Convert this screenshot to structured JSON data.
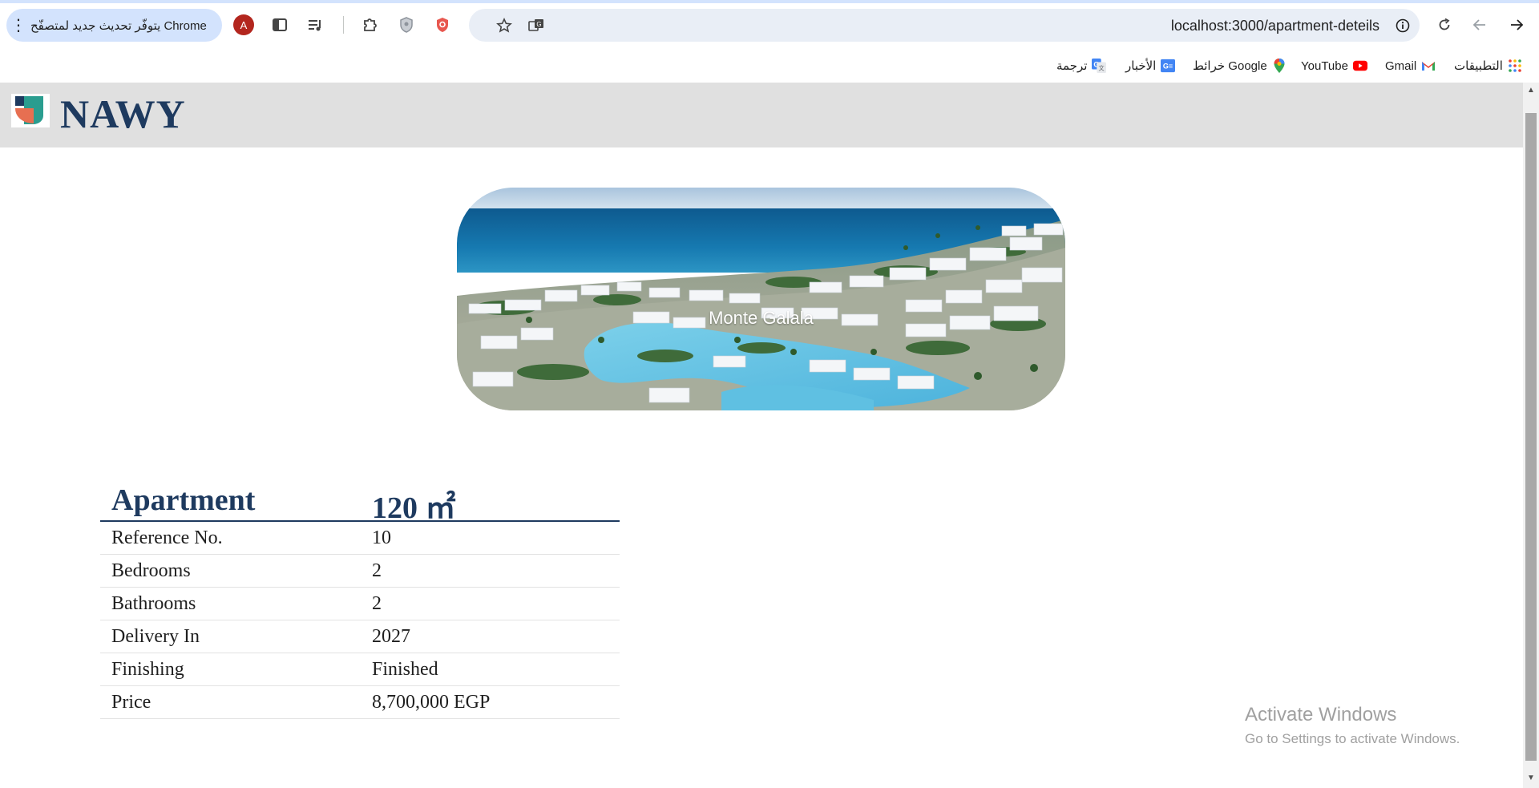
{
  "browser": {
    "update_text": "يتوفّر تحديث جديد لمتصفّح Chrome",
    "update_menu_glyph": "⋮",
    "profile_initial": "A",
    "url": "localhost:3000/apartment-deteils"
  },
  "bookmarks": [
    {
      "label": "التطبيقات",
      "icon": "apps-grid-icon"
    },
    {
      "label": "Gmail",
      "icon": "gmail-icon"
    },
    {
      "label": "YouTube",
      "icon": "youtube-icon"
    },
    {
      "label": "خرائط Google",
      "icon": "maps-icon"
    },
    {
      "label": "الأخبار",
      "icon": "news-icon"
    },
    {
      "label": "ترجمة",
      "icon": "translate-icon"
    }
  ],
  "site": {
    "brand": "NAWY"
  },
  "hero": {
    "caption": "Monte Galala"
  },
  "details": {
    "type": "Apartment",
    "area": "120 ㎡",
    "rows": [
      {
        "label": "Reference No.",
        "value": "10"
      },
      {
        "label": "Bedrooms",
        "value": "2"
      },
      {
        "label": "Bathrooms",
        "value": "2"
      },
      {
        "label": "Delivery In",
        "value": "2027"
      },
      {
        "label": "Finishing",
        "value": "Finished"
      },
      {
        "label": "Price",
        "value": "8,700,000 EGP"
      }
    ]
  },
  "watermark": {
    "title": "Activate Windows",
    "subtitle": "Go to Settings to activate Windows."
  },
  "colors": {
    "brand_navy": "#1e3a5f",
    "header_gray": "#e0e0e0",
    "update_pill": "#d3e3fd",
    "omnibox": "#e9eef6"
  }
}
